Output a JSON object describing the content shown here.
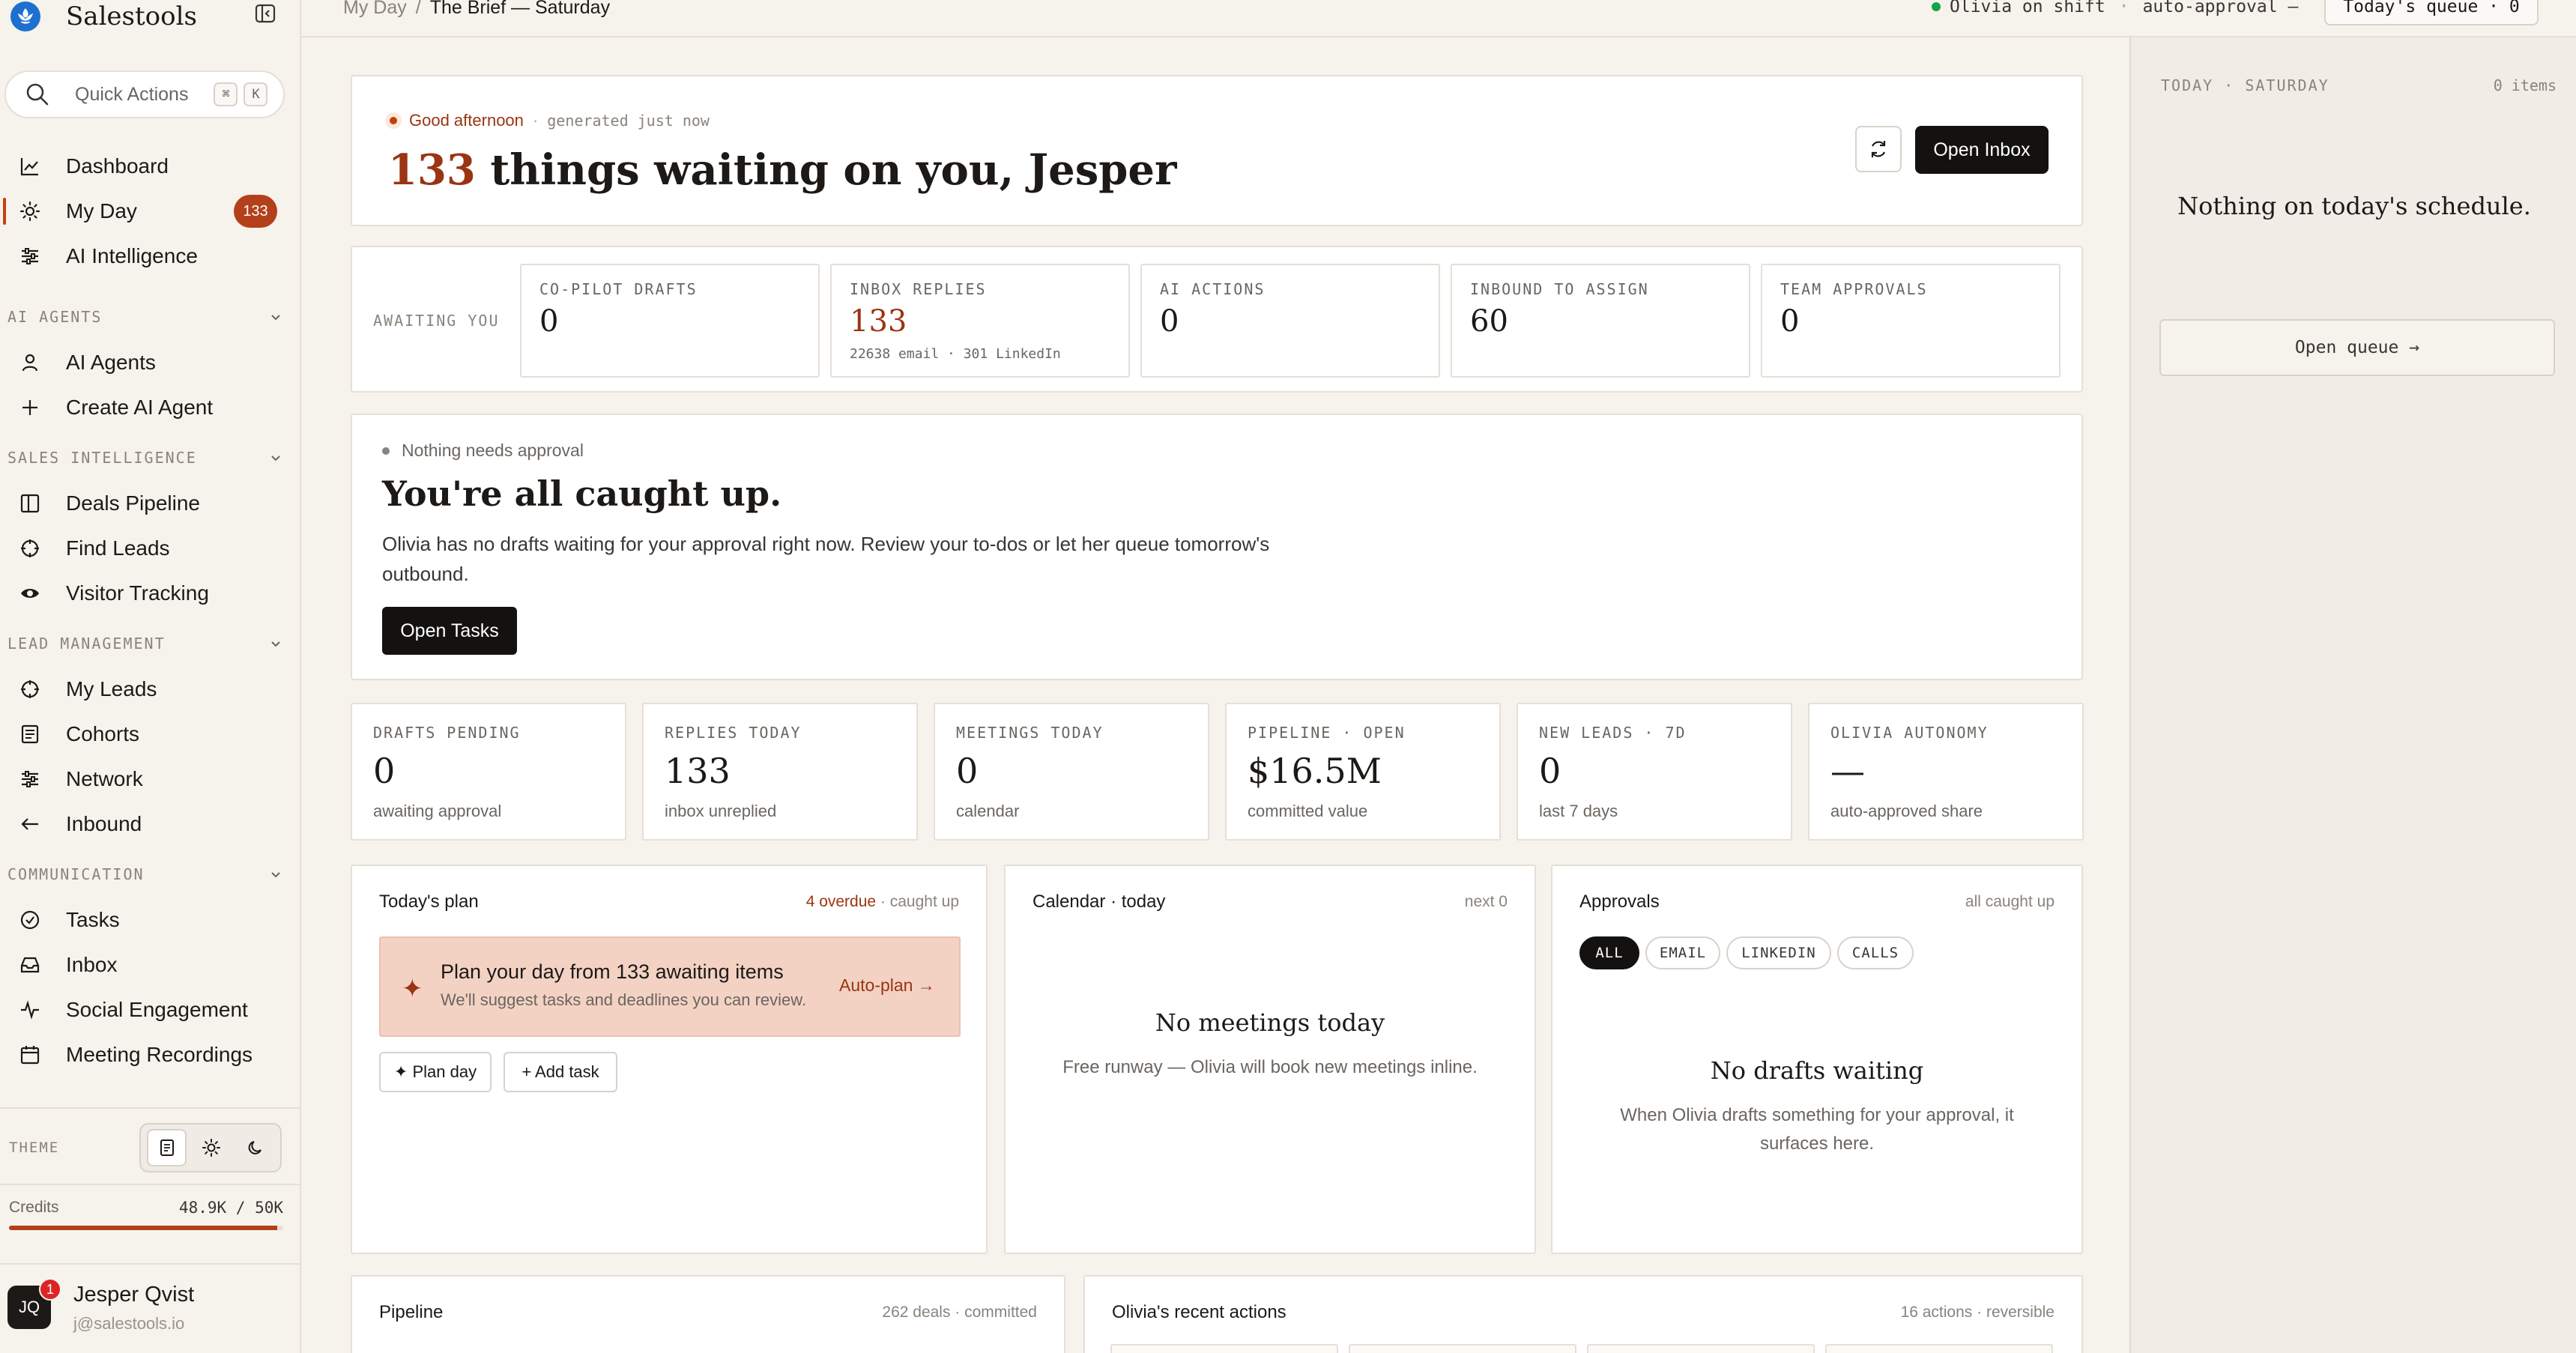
{
  "sidebar": {
    "brand": "Salestools",
    "quick_actions": {
      "label": "Quick Actions",
      "key1": "⌘",
      "key2": "K"
    },
    "top_items": [
      {
        "label": "Dashboard"
      },
      {
        "label": "My Day",
        "badge": "133"
      },
      {
        "label": "AI Intelligence"
      }
    ],
    "sections": {
      "ai_agents": {
        "title": "AI AGENTS",
        "items": [
          "AI Agents",
          "Create AI Agent"
        ]
      },
      "sales_intelligence": {
        "title": "SALES INTELLIGENCE",
        "items": [
          "Deals Pipeline",
          "Find Leads",
          "Visitor Tracking"
        ]
      },
      "lead_management": {
        "title": "LEAD MANAGEMENT",
        "items": [
          "My Leads",
          "Cohorts",
          "Network",
          "Inbound"
        ]
      },
      "communication": {
        "title": "COMMUNICATION",
        "items": [
          "Tasks",
          "Inbox",
          "Social Engagement",
          "Meeting Recordings"
        ]
      }
    },
    "theme_label": "THEME",
    "credits": {
      "label": "Credits",
      "value": "48.9K / 50K",
      "fraction": 0.978
    },
    "user": {
      "initials": "JQ",
      "notifications": "1",
      "name": "Jesper Qvist",
      "email": "j@salestools.io"
    }
  },
  "topbar": {
    "breadcrumb_parent": "My Day",
    "breadcrumb_sep": "/",
    "breadcrumb_current": "The Brief — Saturday",
    "shift_status": "Olivia on shift",
    "shift_sep": "·",
    "approval": "auto-approval —",
    "queue_button": "Today's queue · 0"
  },
  "hero": {
    "greeting": "Good afternoon",
    "sep": "·",
    "generated": "generated just now",
    "headline_count": "133",
    "headline_rest": " things waiting on you, Jesper",
    "open_inbox": "Open Inbox"
  },
  "awaiting": {
    "label": "AWAITING YOU",
    "stats": [
      {
        "label": "CO-PILOT DRAFTS",
        "value": "0",
        "sub": ""
      },
      {
        "label": "INBOX REPLIES",
        "value": "133",
        "sub": "22638 email · 301 LinkedIn"
      },
      {
        "label": "AI ACTIONS",
        "value": "0",
        "sub": ""
      },
      {
        "label": "INBOUND TO ASSIGN",
        "value": "60",
        "sub": ""
      },
      {
        "label": "TEAM APPROVALS",
        "value": "0",
        "sub": ""
      }
    ]
  },
  "caught_up": {
    "status": "Nothing needs approval",
    "title": "You're all caught up.",
    "body": "Olivia has no drafts waiting for your approval right now. Review your to-dos or let her queue tomorrow's outbound.",
    "button": "Open Tasks"
  },
  "metrics": [
    {
      "label": "DRAFTS PENDING",
      "value": "0",
      "sub": "awaiting approval"
    },
    {
      "label": "REPLIES TODAY",
      "value": "133",
      "sub": "inbox unreplied"
    },
    {
      "label": "MEETINGS TODAY",
      "value": "0",
      "sub": "calendar"
    },
    {
      "label": "PIPELINE · OPEN",
      "value": "$16.5M",
      "sub": "committed value"
    },
    {
      "label": "NEW LEADS · 7D",
      "value": "0",
      "sub": "last 7 days"
    },
    {
      "label": "OLIVIA AUTONOMY",
      "value": "—",
      "sub": "auto-approved share"
    }
  ],
  "todays_plan": {
    "title": "Today's plan",
    "overdue": "4 overdue",
    "status": " · caught up",
    "banner_title": "Plan your day from 133 awaiting items",
    "banner_sub": "We'll suggest tasks and deadlines you can review.",
    "banner_link": "Auto-plan →",
    "plan_day": "✦ Plan day",
    "add_task": "+ Add task"
  },
  "calendar": {
    "title": "Calendar · today",
    "right": "next 0",
    "empty_title": "No meetings today",
    "empty_sub": "Free runway — Olivia will book new meetings inline."
  },
  "approvals": {
    "title": "Approvals",
    "right": "all caught up",
    "chips": [
      "ALL",
      "EMAIL",
      "LINKEDIN",
      "CALLS"
    ],
    "empty_title": "No drafts waiting",
    "empty_sub": "When Olivia drafts something for your approval, it surfaces here."
  },
  "pipeline": {
    "title": "Pipeline",
    "right": "262 deals · committed"
  },
  "recent_actions": {
    "title": "Olivia's recent actions",
    "right": "16 actions · reversible"
  },
  "right_panel": {
    "header": "TODAY · SATURDAY",
    "count": "0 items",
    "empty": "Nothing on today's schedule.",
    "button": "Open queue →"
  }
}
